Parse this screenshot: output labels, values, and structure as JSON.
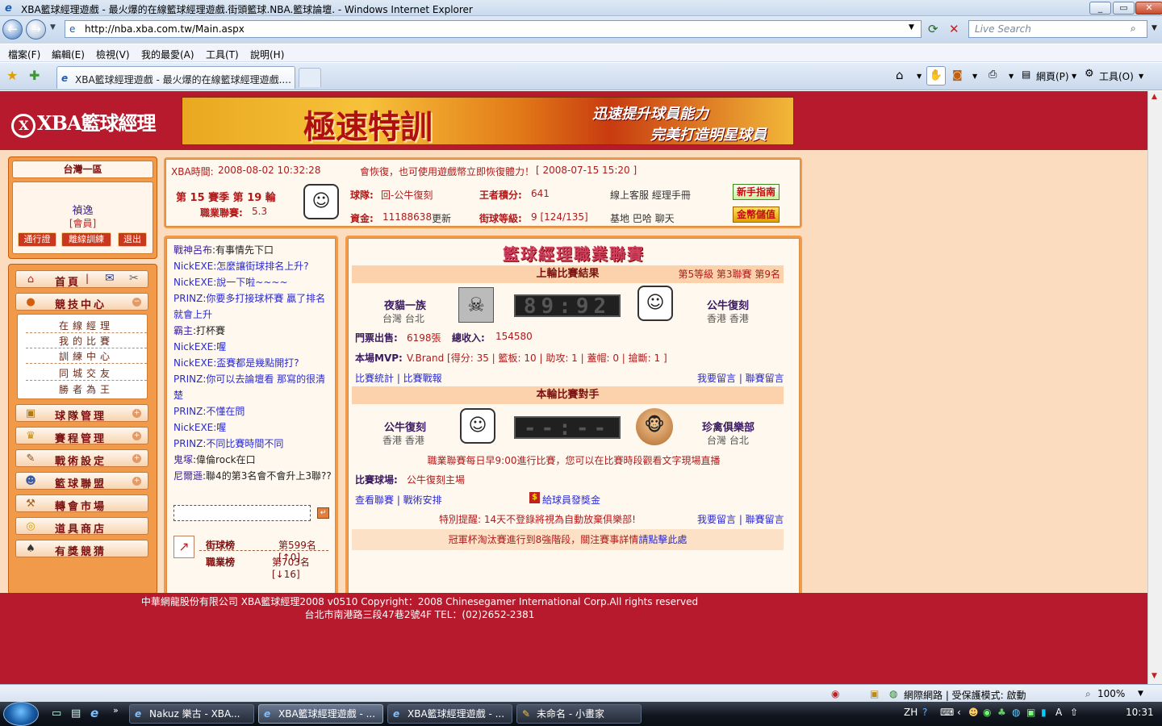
{
  "window": {
    "title": "XBA籃球經理遊戲 - 最火爆的在線籃球經理遊戲.街頭籃球.NBA.籃球論壇. - Windows Internet Explorer"
  },
  "browser": {
    "address": "http://nba.xba.com.tw/Main.aspx",
    "search_placeholder": "Live Search",
    "menu": [
      "檔案(F)",
      "編輯(E)",
      "檢視(V)",
      "我的最愛(A)",
      "工具(T)",
      "說明(H)"
    ],
    "tab_title": "XBA籃球經理遊戲 - 最火爆的在線籃球經理遊戲....",
    "tools": {
      "page": "網頁(P)",
      "tools": "工具(O)"
    }
  },
  "site": {
    "logo": "XBA籃球經理",
    "banner": {
      "main": "極速特訓",
      "line1": "迅速提升球員能力",
      "line2": "完美打造明星球員"
    }
  },
  "left": {
    "server": "台灣一區",
    "user": {
      "name": "禎逸",
      "role": "[會員]"
    },
    "buttons": [
      "通行證",
      "離線訓練",
      "退出"
    ],
    "nav": {
      "home": "首頁",
      "competition": "競技中心",
      "sub": [
        "在線經理",
        "我的比賽",
        "訓練中心",
        "同城交友",
        "勝者為王"
      ],
      "items": [
        "球隊管理",
        "賽程管理",
        "戰術設定",
        "籃球聯盟",
        "轉會市場",
        "道具商店",
        "有獎競猜"
      ]
    }
  },
  "info": {
    "time_label": "XBA時間:",
    "time": "2008-08-02 10:32:28",
    "notice": "會恢復，也可使用遊戲幣立即恢復體力！",
    "notice_date": "[ 2008-07-15 15:20 ]",
    "season": "第 15 賽季 第 19 輪",
    "league_label": "職業聯賽:",
    "league": "5.3",
    "team_label": "球隊:",
    "team": "回-公牛復刻",
    "points_label": "王者積分:",
    "points": "641",
    "links1": "線上客服  經理手冊",
    "funds_label": "資金:",
    "funds": "11188638",
    "update": "更新",
    "level_label": "街球等級:",
    "level": "9 [124/135]",
    "links2": "基地  巴哈  聊天",
    "btn_guide": "新手指南",
    "btn_store": "金幣儲值"
  },
  "chat": {
    "messages": [
      {
        "u": "戰神呂布",
        "m": ":有事情先下口"
      },
      {
        "u": "NickEXE",
        "m": ":怎麼讓街球排名上升?"
      },
      {
        "u": "NickEXE",
        "m": ":說一下啦~~~~"
      },
      {
        "u": "PRINZ",
        "m": ":你要多打接球杯賽  贏了排名就會上升"
      },
      {
        "u": "霸主",
        "m": ":打杯賽"
      },
      {
        "u": "NickEXE",
        "m": ":喔"
      },
      {
        "u": "NickEXE",
        "m": ":盃賽都是幾點開打?"
      },
      {
        "u": "PRINZ",
        "m": ":你可以去論壇看  那寫的很清楚"
      },
      {
        "u": "PRINZ",
        "m": ":不懂在問"
      },
      {
        "u": "NickEXE",
        "m": ":喔"
      },
      {
        "u": "PRINZ",
        "m": ":不同比賽時間不同"
      },
      {
        "u": "鬼塚",
        "m": ":偉倫rock在口"
      },
      {
        "u": "尼爾遜",
        "m": ":聯4的第3名會不會升上3聯??"
      }
    ],
    "rank1_label": "街球榜",
    "rank1": "第599名[↑0]",
    "rank2_label": "職業榜",
    "rank2": "第703名[↓16]"
  },
  "league": {
    "title": "籃球經理職業聯賽",
    "last_header": "上輪比賽結果",
    "last_level": "第5等級  第3聯賽  第9名",
    "home_team": "夜貓一族",
    "home_city": "台灣  台北",
    "score": "89:92",
    "away_team": "公牛復刻",
    "away_city": "香港  香港",
    "tickets_label": "門票出售:",
    "tickets": "6198張",
    "revenue_label": "總收入:",
    "revenue": "154580",
    "mvp_label": "本場MVP:",
    "mvp": "V.Brand [得分: 35 | 籃板: 10 | 助攻: 1 | 蓋帽: 0 | 搶斷: 1 ]",
    "links_a": "比賽統計 | 比賽戰報",
    "links_b": "我要留言 | 聯賽留言",
    "next_header": "本輪比賽對手",
    "next_home": "公牛復刻",
    "next_home_city": "香港  香港",
    "next_score": "--:--",
    "next_away": "珍禽俱樂部",
    "next_away_city": "台灣  台北",
    "schedule_note": "職業聯賽每日早9:00進行比賽，您可以在比賽時段觀看文字現場直播",
    "venue_label": "比賽球場:",
    "venue": "公牛復刻主場",
    "links_c": "查看聯賽 | 戰術安排",
    "bonus": "給球員發獎金",
    "reminder": "特別提醒:    14天不登錄將視為自動放棄俱樂部!",
    "links_d": "我要留言 | 聯賽留言",
    "cup_note": "冠軍杯淘汰賽進行到8強階段，關注賽事詳情",
    "cup_link": "請點擊此處"
  },
  "footer": {
    "line1": "中華網龍股份有限公司  XBA籃球經理2008 v0510     Copyright：2008 Chinesegamer International Corp.All rights reserved",
    "line2": "台北市南港路三段47巷2號4F TEL：(02)2652-2381"
  },
  "status": {
    "zone": "網際網路 | 受保護模式: 啟動",
    "zoom": "100%"
  },
  "taskbar": {
    "tasks": [
      "Nakuz 樂古 - XBA...",
      "XBA籃球經理遊戲 - ...",
      "XBA籃球經理遊戲 - ...",
      "未命名 - 小畫家"
    ],
    "lang": "ZH",
    "clock": "10:31"
  }
}
